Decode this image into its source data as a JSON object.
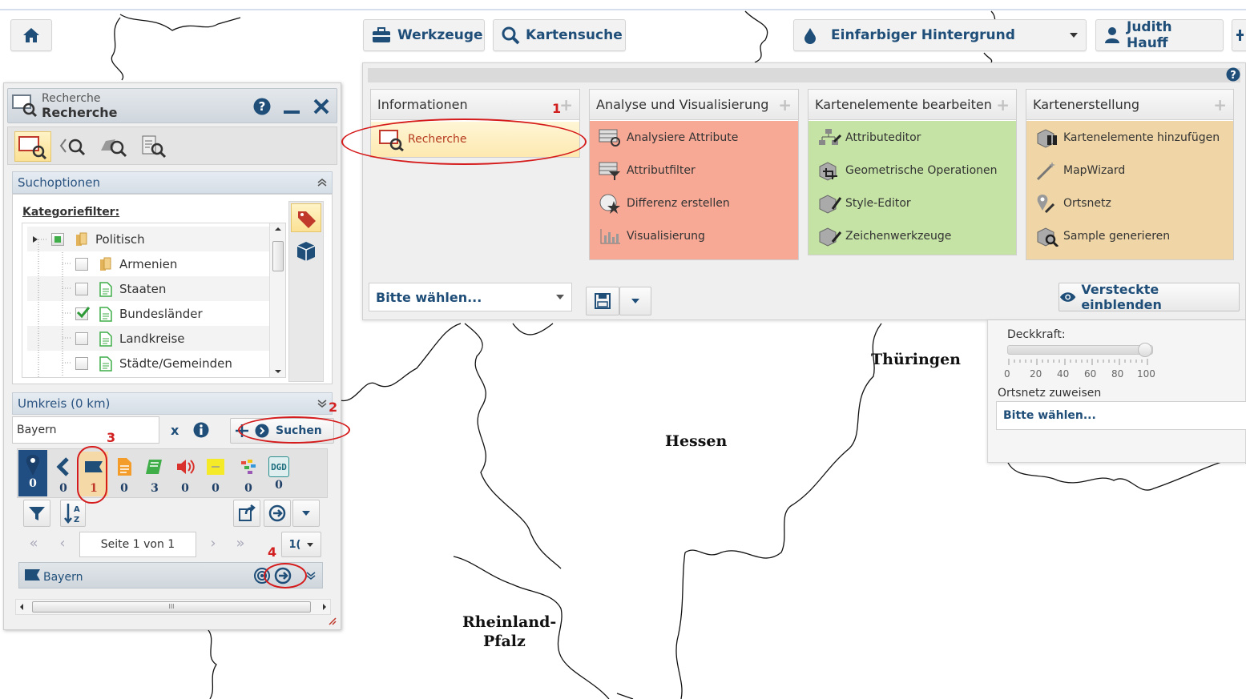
{
  "toolbar": {
    "home_label": "",
    "werkzeuge_label": "Werkzeuge",
    "kartensuche_label": "Kartensuche",
    "background_label": "Einfarbiger Hintergrund",
    "user_label": "Judith Hauff"
  },
  "map_labels": {
    "thueringen": "Thüringen",
    "hessen": "Hessen",
    "rheinland": "Rheinland-",
    "pfalz": "Pfalz"
  },
  "tool_panel": {
    "columns": [
      {
        "title": "Informationen",
        "color": "#ffffff",
        "items": [
          "Recherche"
        ]
      },
      {
        "title": "Analyse und Visualisierung",
        "color": "#f7a996",
        "items": [
          "Analysiere Attribute",
          "Attributfilter",
          "Differenz erstellen",
          "Visualisierung"
        ]
      },
      {
        "title": "Kartenelemente bearbeiten",
        "color": "#c5e3a5",
        "items": [
          "Attributeditor",
          "Geometrische Operationen",
          "Style-Editor",
          "Zeichenwerkzeuge"
        ]
      },
      {
        "title": "Kartenerstellung",
        "color": "#f0d6a6",
        "items": [
          "Kartenelemente hinzufügen",
          "MapWizard",
          "Ortsnetz",
          "Sample generieren"
        ]
      }
    ],
    "select_label": "Bitte wählen...",
    "show_hidden_label": "Versteckte einblenden"
  },
  "opacity_panel": {
    "deckkraft_label": "Deckkraft:",
    "ticks": [
      "0",
      "20",
      "40",
      "60",
      "80",
      "100"
    ],
    "opacity_value": 1.0,
    "ortsnetz_label": "Ortsnetz zuweisen",
    "ortsnetz_select": "Bitte wählen..."
  },
  "research_panel": {
    "title_small": "Recherche",
    "title": "Recherche",
    "search_options_label": "Suchoptionen",
    "category_filter_label": "Kategoriefilter:",
    "tree": [
      {
        "label": "Politisch",
        "checked": "partial"
      },
      {
        "label": "Armenien",
        "checked": false
      },
      {
        "label": "Staaten",
        "checked": false
      },
      {
        "label": "Bundesländer",
        "checked": true
      },
      {
        "label": "Landkreise",
        "checked": false
      },
      {
        "label": "Städte/Gemeinden",
        "checked": false
      }
    ],
    "radius_label": "Umkreis (0 km)",
    "search_value": "Bayern",
    "clear_label": "x",
    "search_button": "Suchen",
    "result_counts": [
      "0",
      "0",
      "1",
      "0",
      "3",
      "0",
      "0",
      "0",
      "0"
    ],
    "result_dgd_label": "DGD",
    "page_label": "Seite 1 von 1",
    "page_size": "1(",
    "result_item": "Bayern",
    "scroll_mark": "III"
  },
  "annotations": {
    "n1": "1",
    "n2": "2",
    "n3": "3",
    "n4": "4"
  }
}
